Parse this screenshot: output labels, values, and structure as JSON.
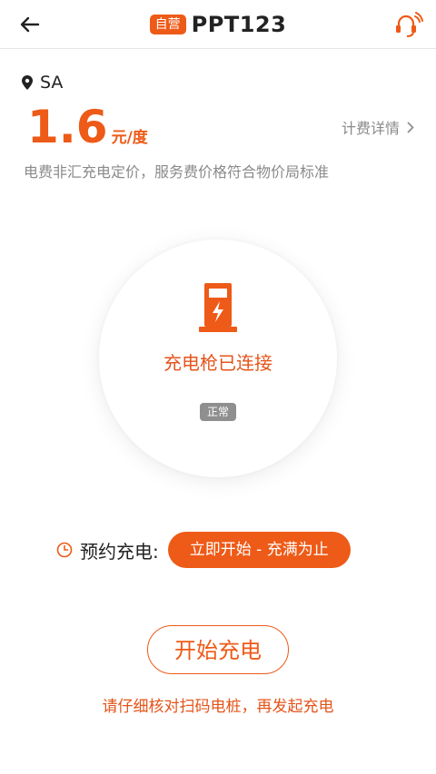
{
  "header": {
    "badge": "自营",
    "title": "PPT123",
    "back_icon": "back-arrow-icon",
    "service_icon": "customer-service-icon"
  },
  "location": {
    "icon": "location-pin-icon",
    "text": "SA"
  },
  "price": {
    "value": "1.6",
    "unit": "元/度"
  },
  "fee_detail": {
    "label": "计费详情",
    "icon": "chevron-right-icon"
  },
  "notice": "电费非汇充电定价，服务费价格符合物价局标准",
  "status": {
    "icon": "charging-pile-icon",
    "text": "充电枪已连接",
    "badge": "正常"
  },
  "schedule": {
    "icon": "clock-icon",
    "label": "预约充电:",
    "button_label": "立即开始 - 充满为止"
  },
  "start_button": "开始充电",
  "hint": "请仔细核对扫码电桩，再发起充电",
  "colors": {
    "accent": "#ee5a17",
    "muted": "#8a8a8a",
    "badge_gray": "#8f8f8f"
  }
}
